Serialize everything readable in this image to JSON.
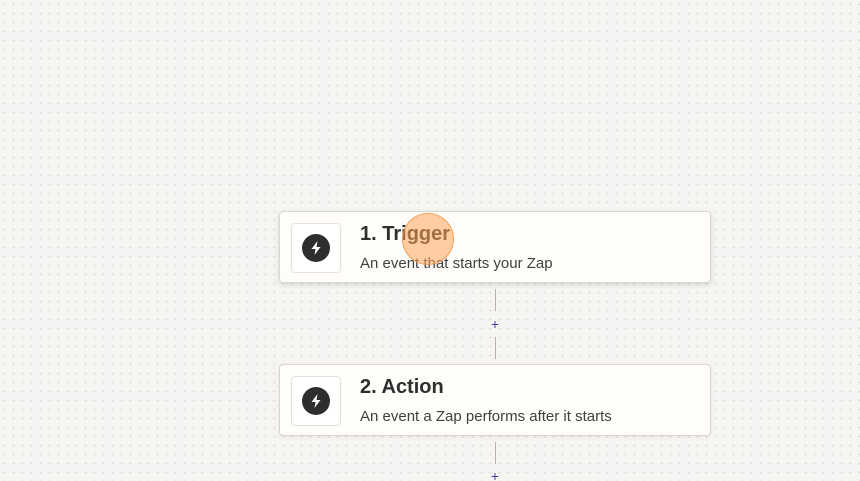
{
  "steps": [
    {
      "title": "1. Trigger",
      "description": "An event that starts your Zap",
      "icon": "bolt-icon"
    },
    {
      "title": "2. Action",
      "description": "An event a Zap performs after it starts",
      "icon": "bolt-icon"
    }
  ],
  "connectors": {
    "add_label": "+"
  },
  "colors": {
    "icon_fill": "#2d2e2e",
    "plus_color": "#4a3fa0",
    "cursor_highlight": "#ffa65a"
  }
}
